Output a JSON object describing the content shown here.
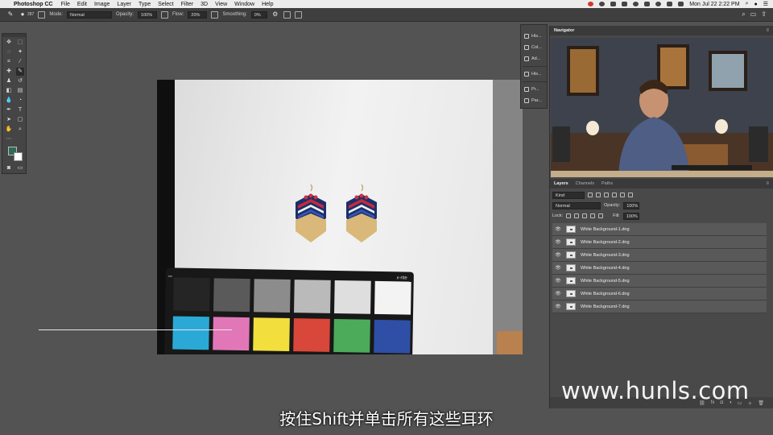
{
  "menubar": {
    "app_name": "Photoshop CC",
    "items": [
      "File",
      "Edit",
      "Image",
      "Layer",
      "Type",
      "Select",
      "Filter",
      "3D",
      "View",
      "Window",
      "Help"
    ],
    "clock": "Mon Jul 22  2:22 PM"
  },
  "options_bar": {
    "brush_size": "287",
    "mode_label": "Mode:",
    "mode_value": "Normal",
    "opacity_label": "Opacity:",
    "opacity_value": "100%",
    "flow_label": "Flow:",
    "flow_value": "20%",
    "smoothing_label": "Smoothing:",
    "smoothing_value": "0%"
  },
  "colors": {
    "foreground": "#2f6a57",
    "background": "#ffffff",
    "ui_dark": "#3f3f3f",
    "panel": "#494949"
  },
  "tools": [
    "move-icon",
    "marquee-icon",
    "lasso-icon",
    "magic-wand-icon",
    "crop-icon",
    "eyedropper-icon",
    "healing-icon",
    "brush-icon",
    "stamp-icon",
    "history-brush-icon",
    "eraser-icon",
    "gradient-icon",
    "blur-icon",
    "dodge-icon",
    "pen-icon",
    "type-icon",
    "path-select-icon",
    "shape-icon",
    "hand-icon",
    "zoom-icon",
    "edit-toolbar-icon"
  ],
  "dock": {
    "items": [
      "His...",
      "Col...",
      "Ad...",
      "His...",
      "Pr...",
      "Par..."
    ]
  },
  "navigator": {
    "tab": "Navigator"
  },
  "checker": {
    "brand": "x-rite"
  },
  "layers_panel": {
    "tabs": [
      "Layers",
      "Channels",
      "Paths"
    ],
    "filter_kind": "Kind",
    "blend_mode": "Normal",
    "opacity_label": "Opacity:",
    "opacity_value": "100%",
    "lock_label": "Lock:",
    "fill_label": "Fill:",
    "fill_value": "100%",
    "layers": [
      {
        "name": "White Background-1.dng"
      },
      {
        "name": "White Background-2.dng"
      },
      {
        "name": "White Background-3.dng"
      },
      {
        "name": "White Background-4.dng"
      },
      {
        "name": "White Background-5.dng"
      },
      {
        "name": "White Background-6.dng"
      },
      {
        "name": "White Background-7.dng"
      }
    ]
  },
  "watermark": "www.hunls.com",
  "subtitle": "按住Shift并单击所有这些耳环"
}
